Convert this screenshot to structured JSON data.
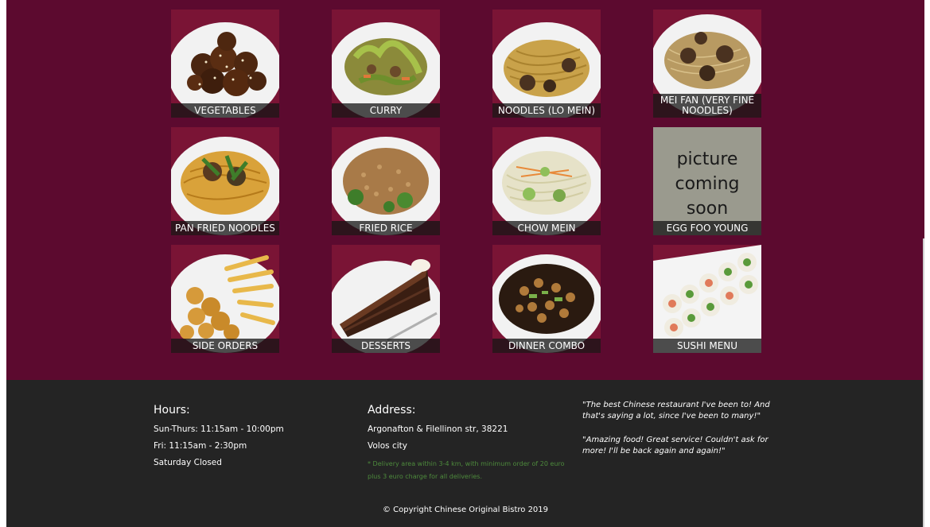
{
  "menu": {
    "items": [
      {
        "label": "VEGETABLES"
      },
      {
        "label": "CURRY"
      },
      {
        "label": "NOODLES (LO MEIN)"
      },
      {
        "label": "MEI FAN (VERY FINE NOODLES)"
      },
      {
        "label": "PAN FRIED NOODLES"
      },
      {
        "label": "FRIED RICE"
      },
      {
        "label": "CHOW MEIN"
      },
      {
        "label": "EGG FOO YOUNG",
        "placeholder": "picture coming soon"
      },
      {
        "label": "SIDE ORDERS"
      },
      {
        "label": "DESSERTS"
      },
      {
        "label": "DINNER COMBO"
      },
      {
        "label": "SUSHI MENU"
      }
    ]
  },
  "footer": {
    "hours": {
      "title": "Hours:",
      "lines": [
        "Sun-Thurs: 11:15am - 10:00pm",
        "Fri: 11:15am - 2:30pm",
        "Saturday Closed"
      ]
    },
    "address": {
      "title": "Address:",
      "lines": [
        "Argonafton & Filellinon str, 38221",
        "Volos city"
      ],
      "note": "* Delivery area within 3-4 km, with minimum order of 20 euro plus 3 euro charge for all deliveries."
    },
    "quotes": [
      "\"The best Chinese restaurant I've been to! And that's saying a lot, since I've been to many!\"",
      "\"Amazing food! Great service! Couldn't ask for more! I'll be back again and again!\""
    ],
    "copyright": "© Copyright Chinese Original Bistro 2019"
  },
  "colors": {
    "page_background": "#5c0a2f",
    "footer_background": "#242424",
    "note_text": "#4d8a3c",
    "caption_bar": "#141414"
  }
}
